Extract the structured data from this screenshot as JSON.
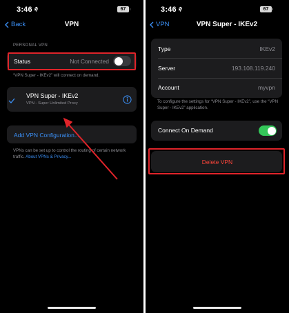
{
  "status_bar": {
    "time": "3:46",
    "battery": "67"
  },
  "left": {
    "nav": {
      "back_label": "Back",
      "title": "VPN"
    },
    "section_label": "PERSONAL VPN",
    "status_row": {
      "label": "Status",
      "value": "Not Connected",
      "toggle_on": false
    },
    "on_demand_note": "“VPN Super - IKEv2” will connect on demand.",
    "vpn_item": {
      "name": "VPN Super - IKEv2",
      "subtitle": "VPN - Super Unlimited Proxy"
    },
    "add_config_label": "Add VPN Configuration...",
    "footer_note": "VPNs can be set up to control the routing of certain network traffic.",
    "footer_link": "About VPNs & Privacy..."
  },
  "right": {
    "nav": {
      "back_label": "VPN",
      "title": "VPN Super - IKEv2"
    },
    "rows": [
      {
        "label": "Type",
        "value": "IKEv2"
      },
      {
        "label": "Server",
        "value": "193.108.119.240"
      },
      {
        "label": "Account",
        "value": "myvpn"
      }
    ],
    "config_note": "To configure the settings for “VPN Super - IKEv2”, use the “VPN Super - IKEv2” application.",
    "connect_on_demand": {
      "label": "Connect On Demand",
      "toggle_on": true
    },
    "delete_label": "Delete VPN"
  },
  "colors": {
    "accent": "#3b8ff5",
    "highlight": "#e0242a",
    "toggle_on": "#34c759",
    "destructive": "#ff453a"
  },
  "icons": [
    "bell-slash-icon",
    "battery-icon",
    "chevron-left-icon",
    "checkmark-icon",
    "info-circle-icon"
  ]
}
